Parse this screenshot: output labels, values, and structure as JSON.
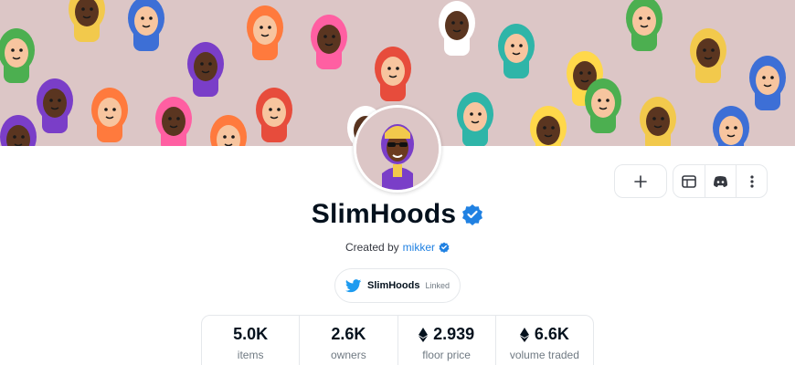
{
  "collection": {
    "name": "SlimHoods",
    "verified_icon": "verified-badge-icon",
    "created_by_prefix": "Created by",
    "creator": "mikker"
  },
  "actions": {
    "add_icon": "plus-icon",
    "website_icon": "website-icon",
    "discord_icon": "discord-icon",
    "more_icon": "more-vertical-icon"
  },
  "linked_account": {
    "platform_icon": "twitter-icon",
    "name": "SlimHoods",
    "status": "Linked"
  },
  "stats": [
    {
      "value": "5.0K",
      "label": "items",
      "eth": false
    },
    {
      "value": "2.6K",
      "label": "owners",
      "eth": false
    },
    {
      "value": "2.939",
      "label": "floor price",
      "eth": true
    },
    {
      "value": "6.6K",
      "label": "volume traded",
      "eth": true
    }
  ],
  "colors": {
    "banner_bg": "#dcc6c6",
    "accent_blue": "#2081e2",
    "text_primary": "#04111d",
    "text_secondary": "#707a83"
  }
}
